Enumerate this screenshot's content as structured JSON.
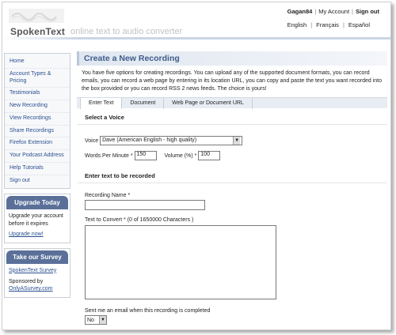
{
  "header": {
    "logo_text": "SpokenText",
    "tagline": "online text to audio converter",
    "user": "Gagan84",
    "my_account": "My Account",
    "sign_out": "Sign out",
    "languages": [
      "English",
      "Français",
      "Español"
    ]
  },
  "sidebar": {
    "nav": [
      "Home",
      "Account Types & Pricing",
      "Testimonials",
      "New Recording",
      "View Recordings",
      "Share Recordings",
      "Firefox Extension",
      "Your Podcast Address",
      "Help Tutorials",
      "Sign out"
    ],
    "upgrade": {
      "title": "Upgrade Today",
      "text": "Upgrade your account before it expires",
      "link": "Upgrade now!"
    },
    "survey": {
      "title": "Take our Survey",
      "link": "SpokenText Survey",
      "sponsored": "Sponsored by",
      "sponsor": "OnlyASurvey.com"
    }
  },
  "main": {
    "title": "Create a New Recording",
    "intro": "You have five options for creating recordings. You can upload any of the supported document formats, you can record emails, you can record a web page by entering in its location URL, you can copy and paste the text you want recorded into the box provided or you can record RSS 2 news feeds. The choice is yours!",
    "tabs": [
      "Enter Text",
      "Document",
      "Web Page or Document URL"
    ],
    "select_voice_heading": "Select a Voice",
    "voice_label": "Voice",
    "voice_value": "Dave (American English - high quality)",
    "wpm_label": "Words Per Minute *",
    "wpm_value": "150",
    "volume_label": "Volume (%) *",
    "volume_value": "100",
    "enter_text_heading": "Enter text to be recorded",
    "recording_name_label": "Recording Name *",
    "text_label": "Text to Convert * (0 of 1650000 Characters )",
    "email_label": "Sent me an email when this recording is completed",
    "email_value": "No"
  }
}
